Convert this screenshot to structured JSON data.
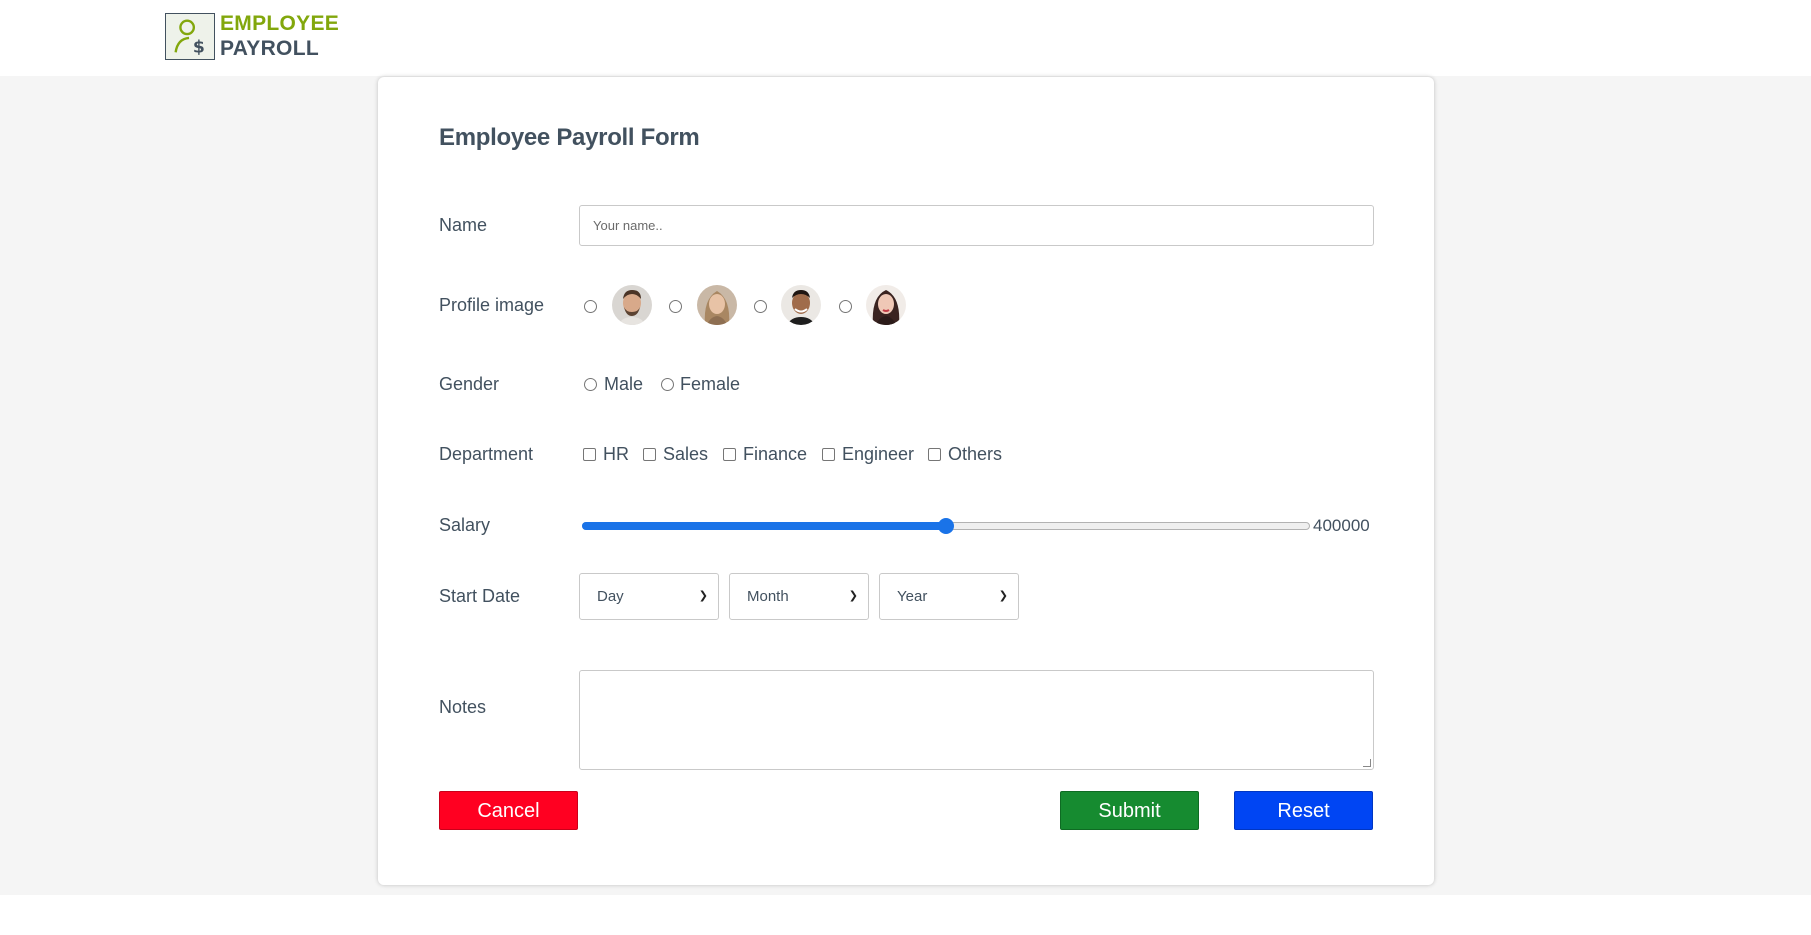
{
  "logo": {
    "line1": "EMPLOYEE",
    "line2": "PAYROLL",
    "icon": "person-dollar-icon"
  },
  "form": {
    "title": "Employee Payroll Form",
    "name": {
      "label": "Name",
      "placeholder": "Your name.."
    },
    "profile_image": {
      "label": "Profile image",
      "options": [
        "avatar-man-1",
        "avatar-woman-1",
        "avatar-man-2",
        "avatar-woman-2"
      ]
    },
    "gender": {
      "label": "Gender",
      "options": [
        "Male",
        "Female"
      ]
    },
    "department": {
      "label": "Department",
      "options": [
        "HR",
        "Sales",
        "Finance",
        "Engineer",
        "Others"
      ]
    },
    "salary": {
      "label": "Salary",
      "value": "400000",
      "fill_fraction": 0.5
    },
    "start_date": {
      "label": "Start Date",
      "day": "Day",
      "month": "Month",
      "year": "Year"
    },
    "notes": {
      "label": "Notes"
    },
    "buttons": {
      "cancel": "Cancel",
      "submit": "Submit",
      "reset": "Reset"
    }
  },
  "colors": {
    "accent_green": "#82a70c",
    "text_dark": "#42515f",
    "cancel_red": "#ff0021",
    "submit_green": "#168b30",
    "reset_blue": "#0045f3",
    "slider_blue": "#1a73e8"
  }
}
